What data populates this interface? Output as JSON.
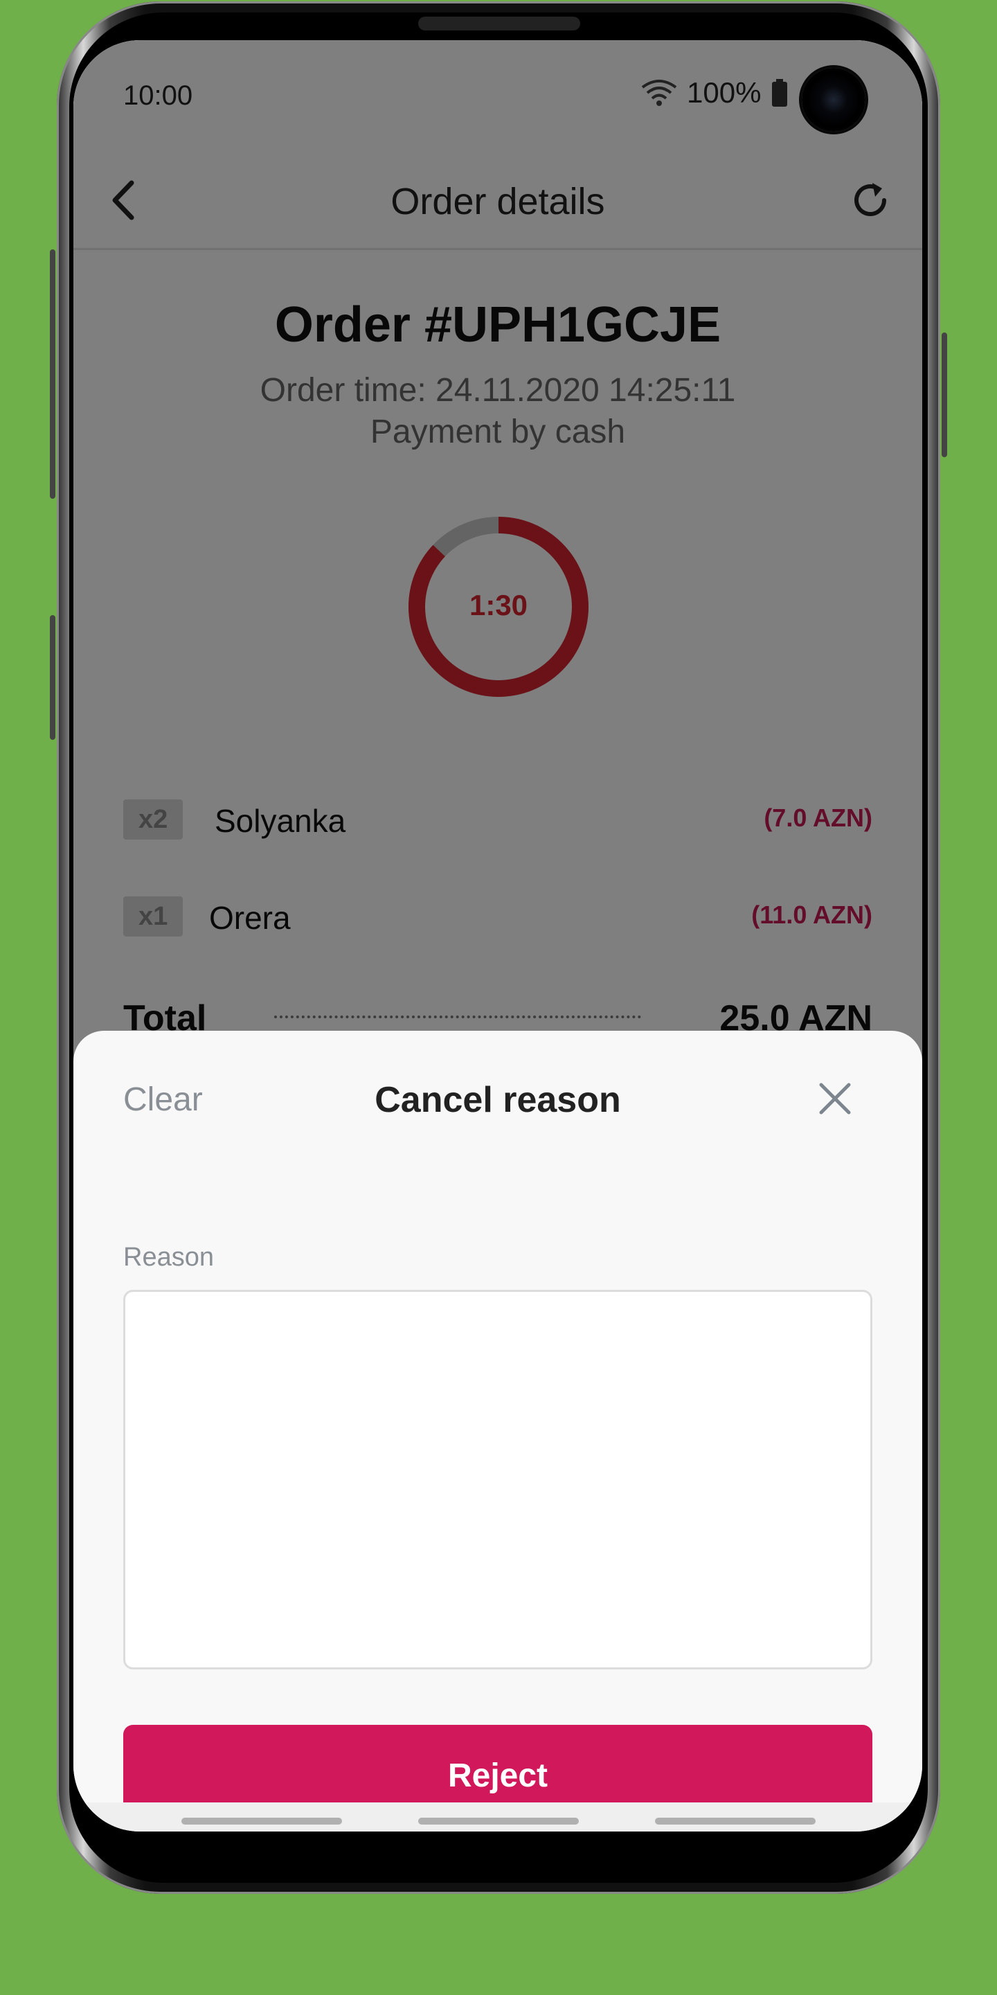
{
  "status_bar": {
    "time": "10:00",
    "battery_text": "100%",
    "wifi_icon": "wifi-icon",
    "battery_icon": "battery-icon"
  },
  "header": {
    "title": "Order details",
    "back_icon": "chevron-left-icon",
    "refresh_icon": "refresh-icon"
  },
  "order": {
    "title": "Order #UPH1GCJE",
    "time_text": "Order time: 24.11.2020 14:25:11",
    "payment_text": "Payment by cash",
    "timer_text": "1:30",
    "timer_progress": 0.87,
    "items": [
      {
        "qty": "x2",
        "name": "Solyanka",
        "price": "(7.0 AZN)"
      },
      {
        "qty": "x1",
        "name": "Orera",
        "price": "(11.0 AZN)"
      }
    ],
    "total_label": "Total",
    "total_value": "25.0 AZN"
  },
  "sheet": {
    "clear_label": "Clear",
    "title": "Cancel reason",
    "close_icon": "close-icon",
    "reason_label": "Reason",
    "reason_value": "",
    "reject_label": "Reject"
  },
  "colors": {
    "background": "#6fb04a",
    "accent": "#d0185a",
    "timer_red": "#d4242e",
    "price": "#c81a55"
  }
}
